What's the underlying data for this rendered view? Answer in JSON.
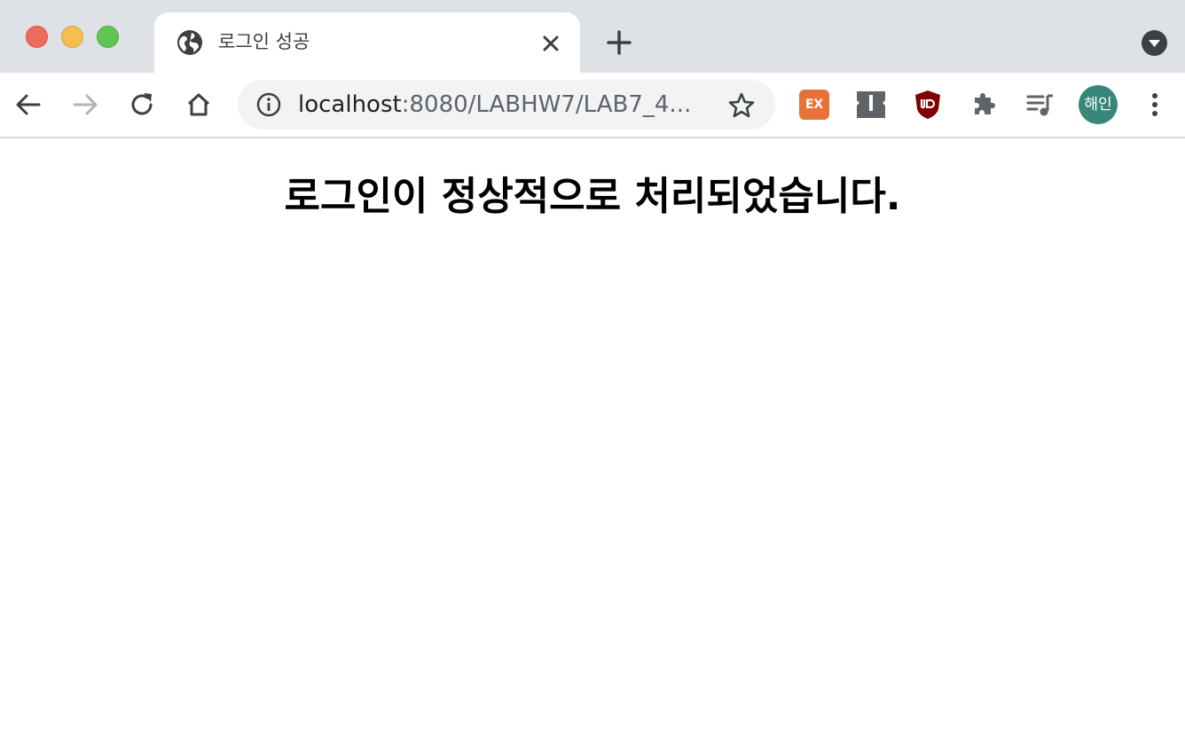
{
  "window": {
    "traffic_lights": {
      "close": "#ed6a5e",
      "minimize": "#f5bf4f",
      "maximize": "#61c554"
    }
  },
  "tab": {
    "title": "로그인 성공",
    "favicon": "globe-icon"
  },
  "toolbar": {
    "url_host": "localhost",
    "url_rest": ":8080/LABHW7/LAB7_4...",
    "extensions": {
      "ex_label": "EX",
      "ex_color": "#e8713a",
      "ublock_color": "#800000"
    },
    "profile": {
      "label": "해인",
      "color": "#39877a"
    }
  },
  "page": {
    "heading": "로그인이 정상적으로 처리되었습니다."
  }
}
